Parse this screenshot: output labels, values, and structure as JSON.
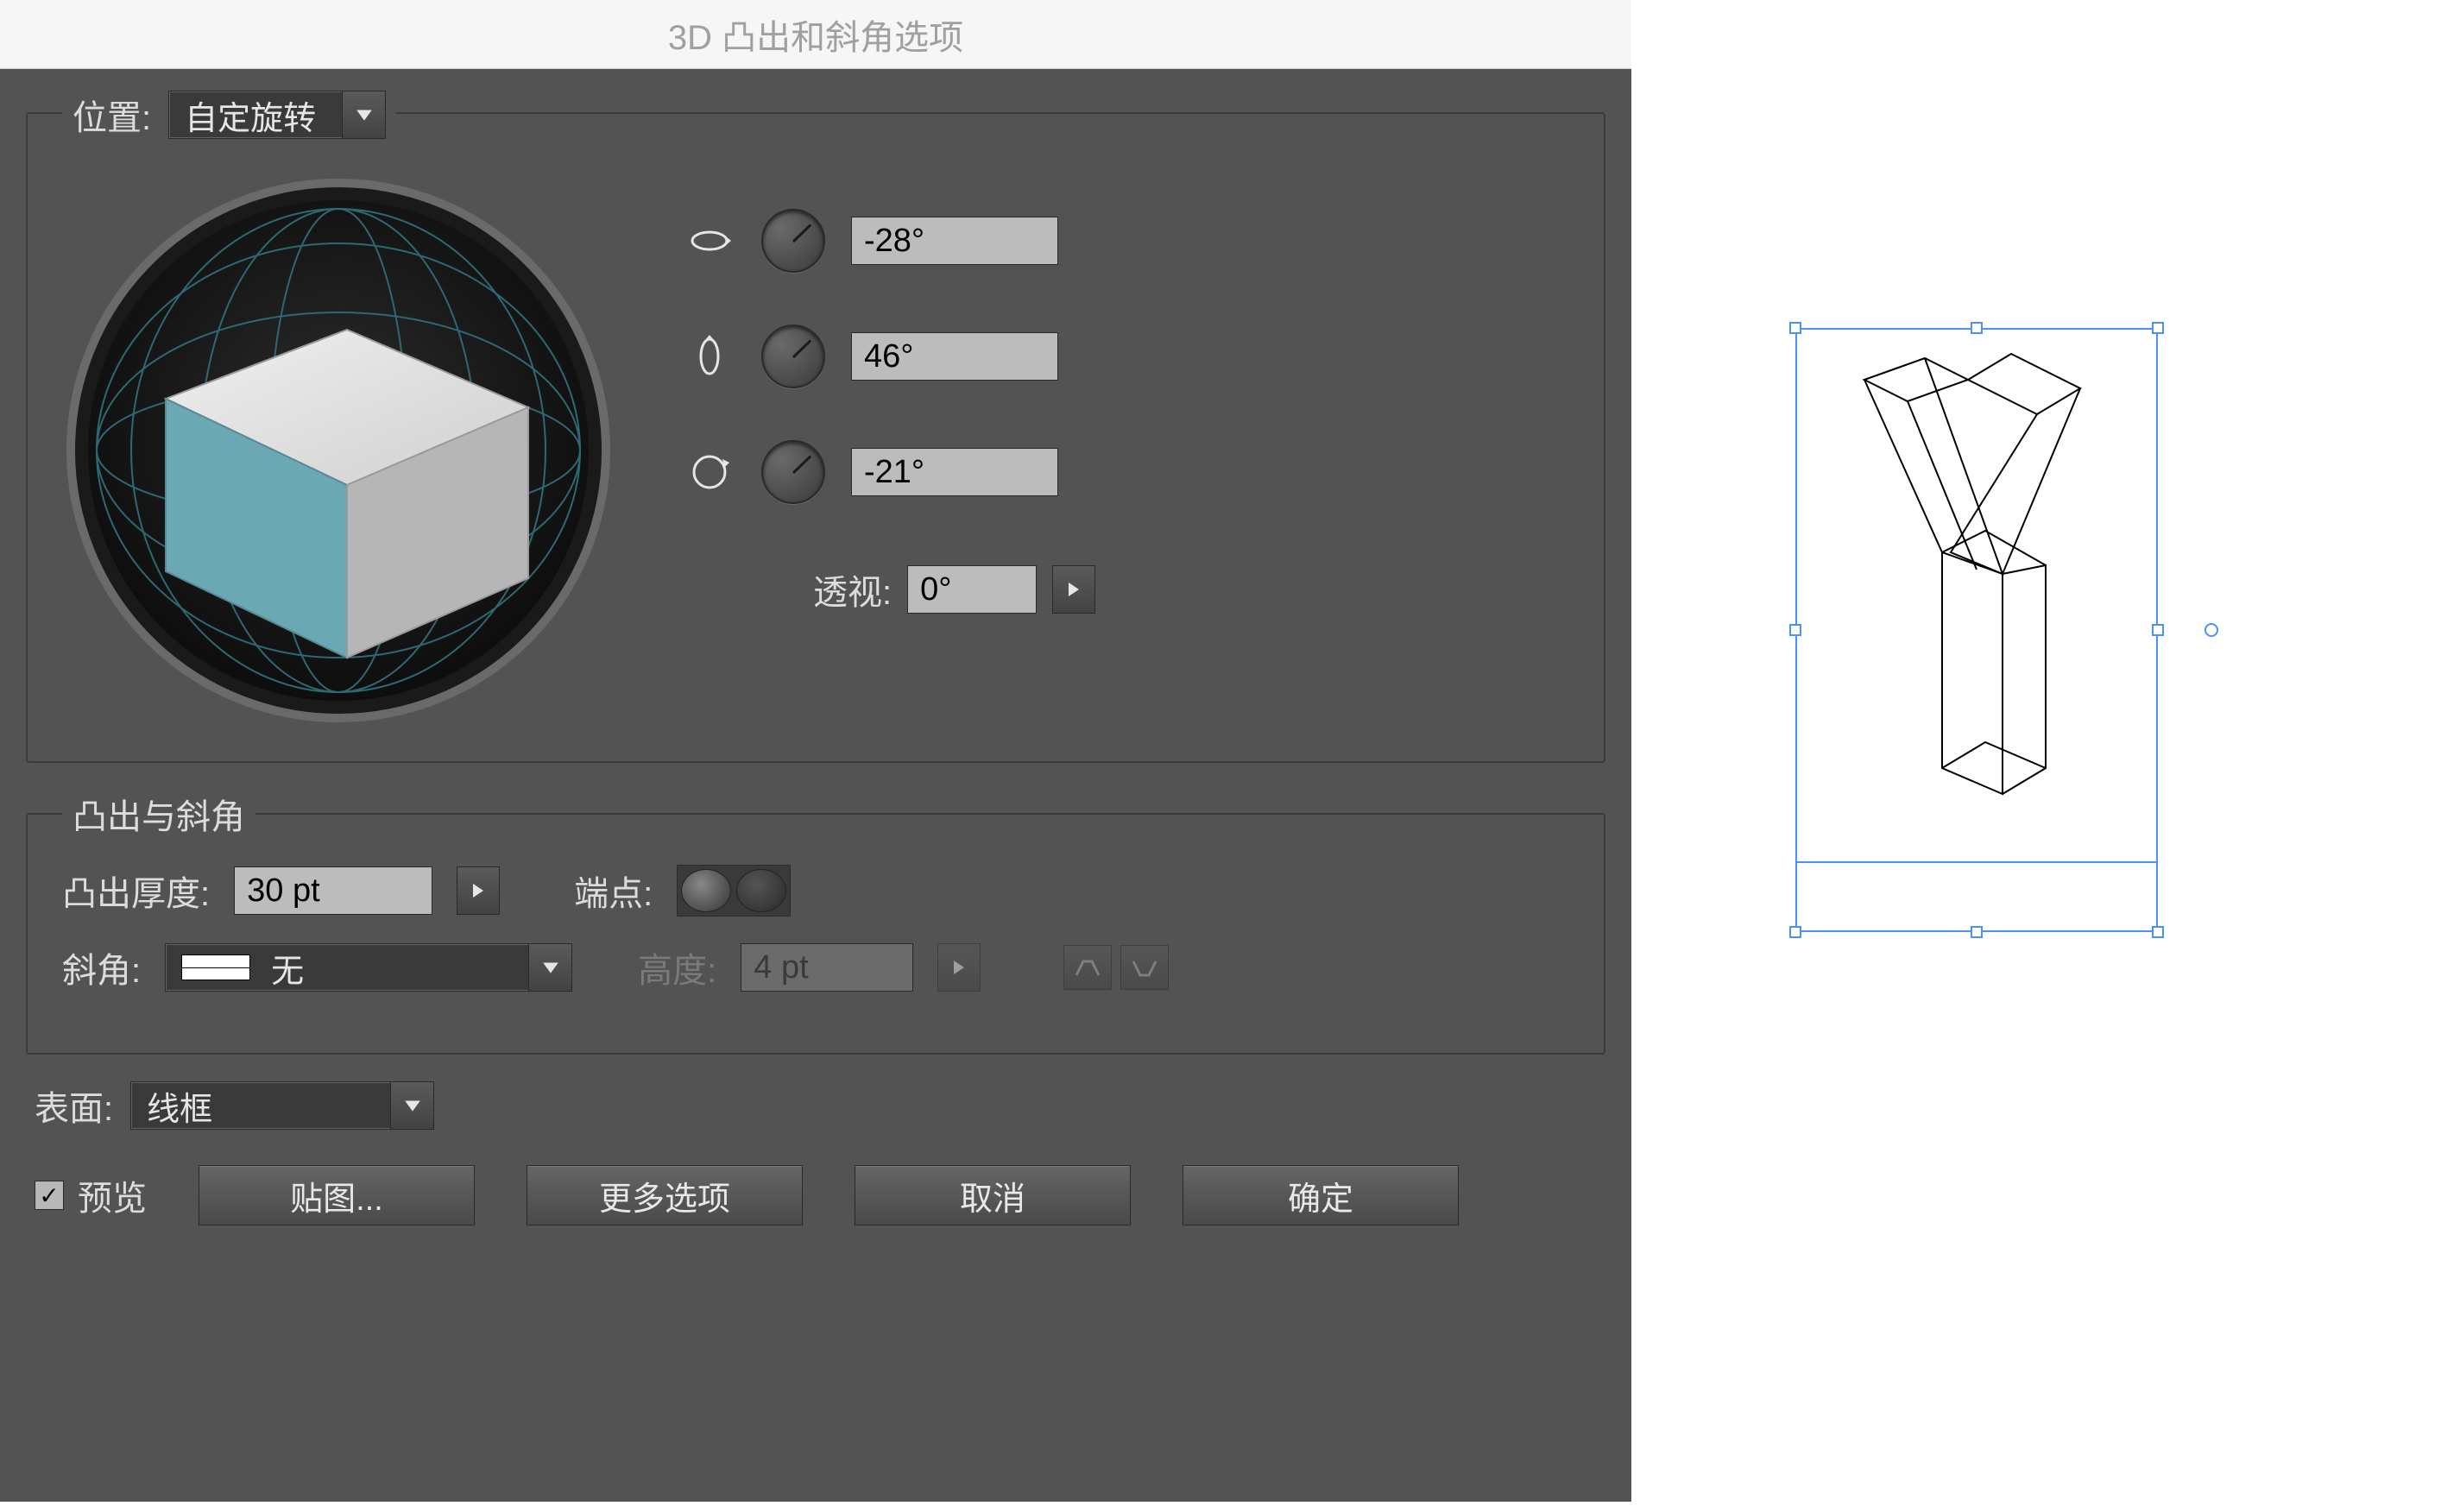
{
  "dialog": {
    "title": "3D 凸出和斜角选项",
    "position_label": "位置:",
    "position_value": "自定旋转",
    "rotation": {
      "x_label": "-28°",
      "y_label": "46°",
      "z_label": "-21°"
    },
    "perspective_label": "透视:",
    "perspective_value": "0°",
    "extrude_group_label": "凸出与斜角",
    "extrude_depth_label": "凸出厚度:",
    "extrude_depth_value": "30 pt",
    "cap_label": "端点:",
    "bevel_label": "斜角:",
    "bevel_value": "无",
    "height_label": "高度:",
    "height_value": "4 pt",
    "surface_label": "表面:",
    "surface_value": "线框",
    "preview_label": "预览",
    "buttons": {
      "map": "贴图...",
      "more": "更多选项",
      "cancel": "取消",
      "ok": "确定"
    }
  }
}
